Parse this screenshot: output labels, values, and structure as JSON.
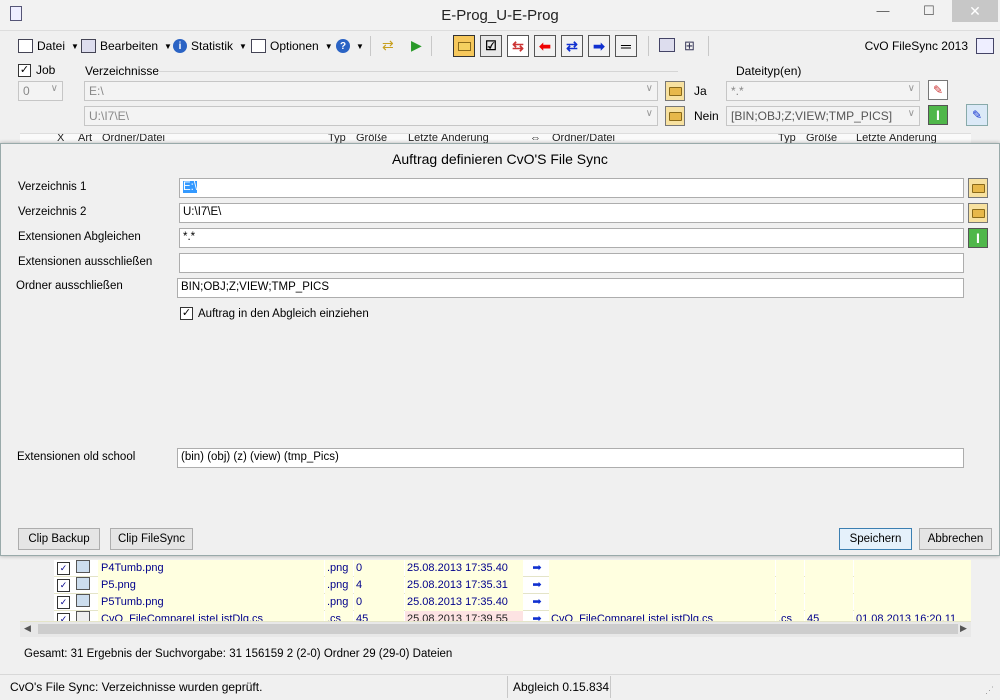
{
  "window": {
    "title": "E-Prog_U-E-Prog",
    "minimize": "—",
    "maximize": "☐",
    "close": "✕"
  },
  "menu": {
    "datei": "Datei",
    "bearbeiten": "Bearbeiten",
    "statistik": "Statistik",
    "optionen": "Optionen",
    "help": "?"
  },
  "brand": "CvO FileSync 2013",
  "job": {
    "label": "Job",
    "checked": true,
    "value": "0"
  },
  "verzeichnisse": {
    "label": "Verzeichnisse",
    "dir1": "E:\\",
    "dir2": "U:\\I7\\E\\"
  },
  "dateityp": {
    "label": "Dateityp(en)",
    "ja_label": "Ja",
    "ja_value": "*.*",
    "nein_label": "Nein",
    "nein_value": "[BIN;OBJ;Z;VIEW;TMP_PICS]"
  },
  "grid_header": {
    "x": "X",
    "art": "Art",
    "ordner1": "Ordner/Datei",
    "typ1": "Typ",
    "groesse1": "Größe",
    "aenderung1": "Letzte Änderung",
    "dir": "⇔",
    "ordner2": "Ordner/Datei",
    "typ2": "Typ",
    "groesse2": "Größe",
    "aenderung2": "Letzte Änderung"
  },
  "dialog": {
    "title": "Auftrag definieren CvO'S File Sync",
    "verzeichnis1_label": "Verzeichnis 1",
    "verzeichnis1_value": "E:\\",
    "verzeichnis2_label": "Verzeichnis 2",
    "verzeichnis2_value": "U:\\I7\\E\\",
    "ext_abgleich_label": "Extensionen Abgleichen",
    "ext_abgleich_value": "*.*",
    "ext_ausschl_label": "Extensionen ausschließen",
    "ext_ausschl_value": "",
    "ordner_ausschl_label": "Ordner ausschließen",
    "ordner_ausschl_value": "BIN;OBJ;Z;VIEW;TMP_PICS",
    "auftrag_label": "Auftrag in den Abgleich einziehen",
    "auftrag_checked": true,
    "ext_old_label": "Extensionen old school",
    "ext_old_value": "(bin) (obj) (z) (view) (tmp_Pics)",
    "clip_backup": "Clip Backup",
    "clip_filesync": "Clip FileSync",
    "speichern": "Speichern",
    "abbrechen": "Abbrechen"
  },
  "rows": [
    {
      "name": "P4Tumb.png",
      "typ": ".png",
      "size": "0",
      "date": "25.08.2013 17:35.40",
      "arrow": "➡",
      "name2": "",
      "typ2": "",
      "size2": "",
      "date2": ""
    },
    {
      "name": "P5.png",
      "typ": ".png",
      "size": "4",
      "date": "25.08.2013 17:35.31",
      "arrow": "➡",
      "name2": "",
      "typ2": "",
      "size2": "",
      "date2": ""
    },
    {
      "name": "P5Tumb.png",
      "typ": ".png",
      "size": "0",
      "date": "25.08.2013 17:35.40",
      "arrow": "➡",
      "name2": "",
      "typ2": "",
      "size2": "",
      "date2": ""
    },
    {
      "name": "CvO_FileCompareListeListDlg.cs",
      "typ": ".cs",
      "size": "45",
      "date": "25.08.2013 17:39.55",
      "arrow": "➡",
      "name2": "CvO_FileCompareListeListDlg.cs",
      "typ2": ".cs",
      "size2": "45",
      "date2": "01.08.2013 16:20.11"
    }
  ],
  "summary": "Gesamt: 31 Ergebnis der Suchvorgabe: 31 156159   2 (2-0) Ordner 29 (29-0) Dateien",
  "statusbar": {
    "message": "CvO's File Sync: Verzeichnisse wurden geprüft.",
    "version": "Abgleich 0.15.834"
  }
}
